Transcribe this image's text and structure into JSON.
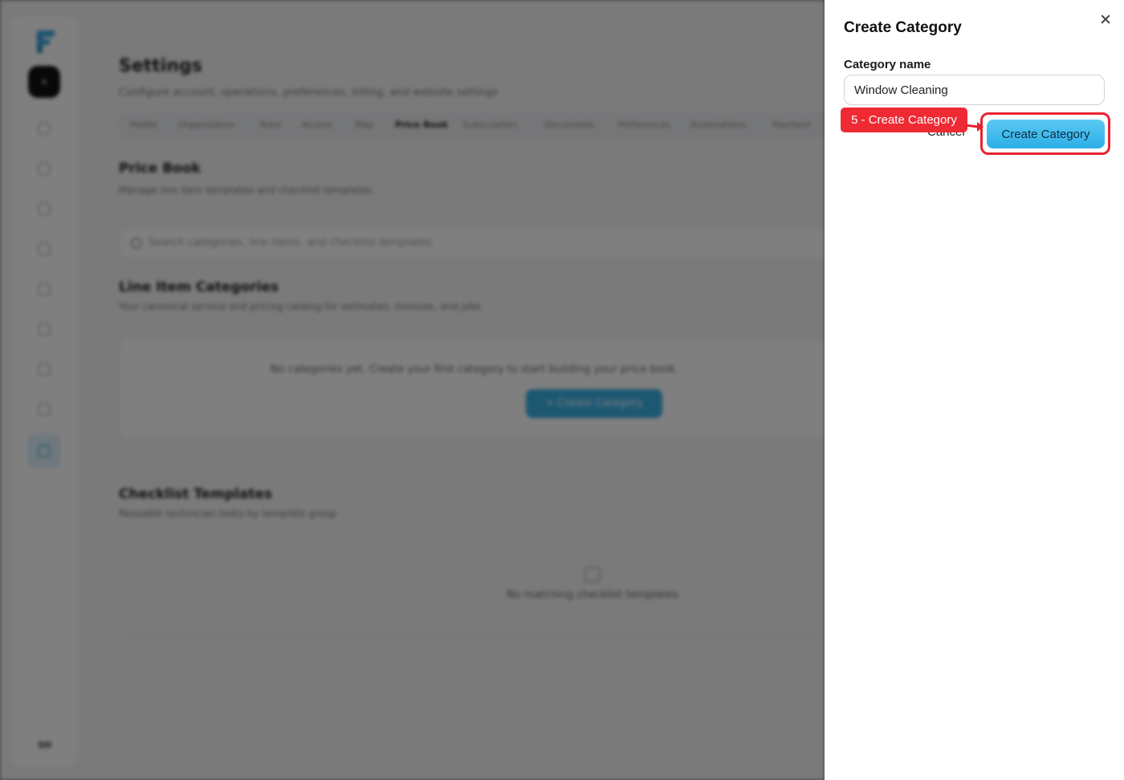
{
  "background": {
    "sidebar": {
      "footer_label": "SH"
    },
    "page_title": "Settings",
    "page_subtitle": "Configure account, operations, preferences, billing, and website settings",
    "tabs": [
      {
        "label": "Profile"
      },
      {
        "label": "Organization"
      },
      {
        "label": "Team"
      },
      {
        "label": "Access"
      },
      {
        "label": "Map"
      },
      {
        "label": "Price Book",
        "active": true
      },
      {
        "label": "Subscription"
      },
      {
        "label": "Documents"
      },
      {
        "label": "Preferences"
      },
      {
        "label": "Automations"
      },
      {
        "label": "Payment"
      }
    ],
    "price_book": {
      "title": "Price Book",
      "subtitle": "Manage line item templates and checklist templates",
      "search_placeholder": "Search categories, line items, and checklist templates"
    },
    "line_item_categories": {
      "title": "Line Item Categories",
      "subtitle": "Your canonical service and pricing catalog for estimates, invoices, and jobs",
      "empty_text": "No categories yet. Create your first category to start building your price book.",
      "create_button": "+ Create Category"
    },
    "checklist_templates": {
      "title": "Checklist Templates",
      "subtitle": "Reusable technician tasks by template group",
      "empty_text": "No matching checklist templates"
    }
  },
  "dialog": {
    "title": "Create Category",
    "field_label": "Category name",
    "field_value": "Window Cleaning",
    "cancel_label": "Cancel",
    "submit_label": "Create Category"
  },
  "annotation": {
    "step_label": "5 - Create Category",
    "color": "#e8232f"
  }
}
